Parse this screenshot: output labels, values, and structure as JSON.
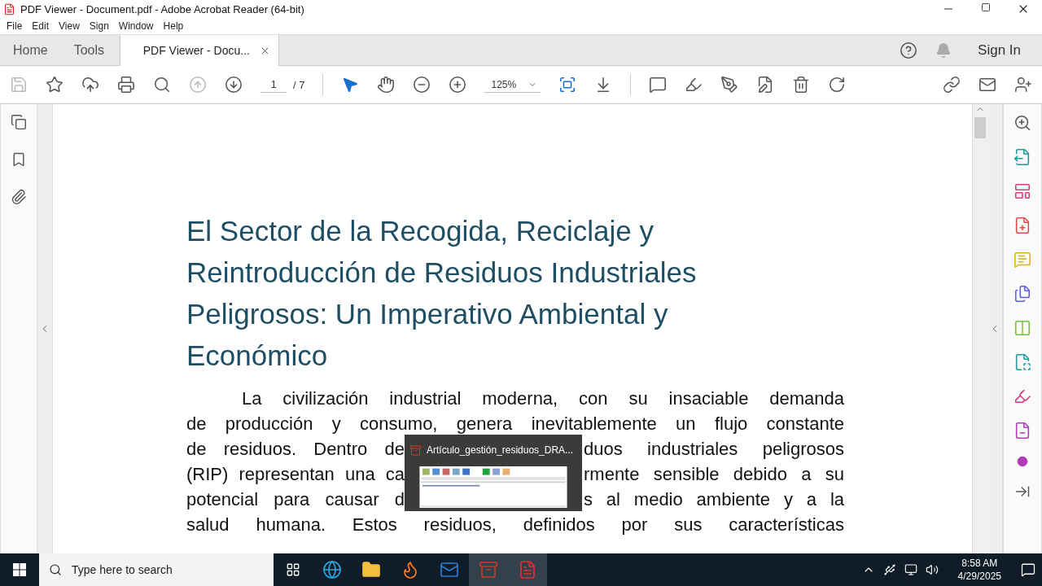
{
  "window": {
    "title": "PDF Viewer - Document.pdf - Adobe Acrobat Reader (64-bit)"
  },
  "menu": [
    "File",
    "Edit",
    "View",
    "Sign",
    "Window",
    "Help"
  ],
  "tabs": [
    {
      "label": "Home",
      "selected": false,
      "kind": "nav"
    },
    {
      "label": "Tools",
      "selected": false,
      "kind": "nav"
    },
    {
      "label": "PDF Viewer - Docu...",
      "selected": true,
      "kind": "document"
    }
  ],
  "sign_in": "Sign In",
  "toolbar": {
    "page": "1",
    "page_total": "/ 7",
    "zoom": "125%"
  },
  "document": {
    "title_lines": [
      "El Sector de la Recogida, Reciclaje y",
      "Reintroducción de Residuos Industriales",
      "Peligrosos: Un Imperativo Ambiental y",
      "Económico"
    ],
    "lines": [
      {
        "kind": "first",
        "text": "La civilización industrial moderna, con su insaciable demanda"
      },
      {
        "kind": "full",
        "text": "de producción y consumo, genera inevitablemente un flujo constante"
      },
      {
        "kind": "split",
        "left": "de residuos. Dentro de",
        "right": "duos industriales peligrosos"
      },
      {
        "kind": "split",
        "left": "(RIP) representan una ca",
        "right": "rmente sensible debido a su"
      },
      {
        "kind": "split",
        "left": "potencial para causar d",
        "right": "s al medio ambiente y a la"
      },
      {
        "kind": "last",
        "text": "salud humana. Estos residuos, definidos por sus características"
      }
    ]
  },
  "preview": {
    "title": "Artículo_gestión_residuos_DRA..."
  },
  "taskbar": {
    "search_placeholder": "Type here to search",
    "time": "8:58 AM",
    "date": "4/29/2025"
  }
}
